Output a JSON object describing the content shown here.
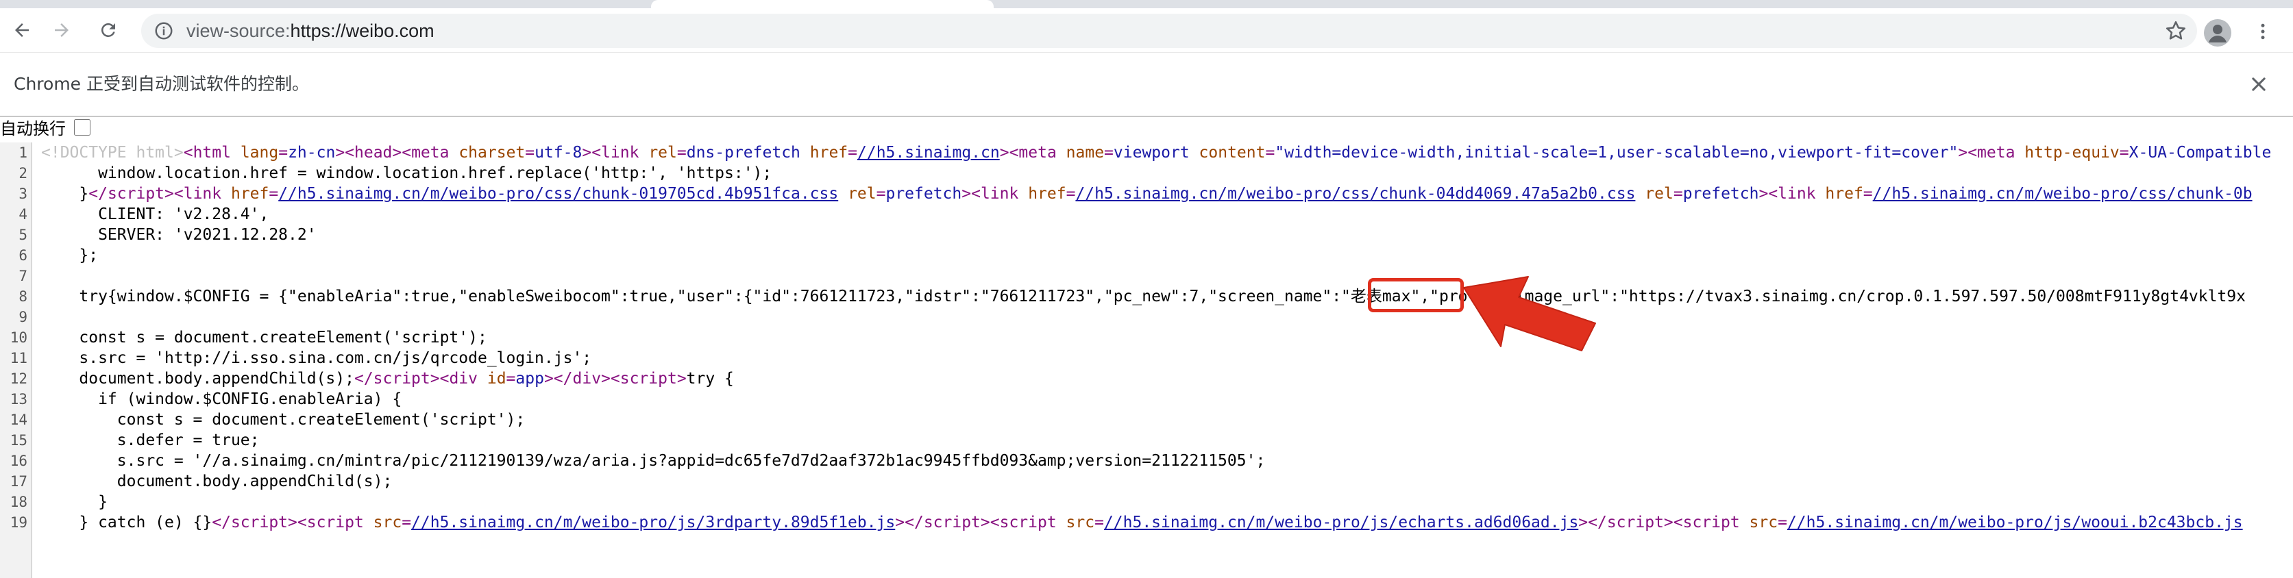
{
  "browser": {
    "url_scheme": "view-source:",
    "url_rest": "https://weibo.com"
  },
  "infobar": {
    "message": "Chrome 正受到自动测试软件的控制。"
  },
  "wrap_toggle": {
    "label": "自动换行"
  },
  "source_lines": [
    {
      "num": "1",
      "html": "<span class=\"doct\">&lt;!DOCTYPE html&gt;</span><span class=\"tag\">&lt;html </span><span class=\"attr\">lang</span><span class=\"tag\">=</span><span class=\"val\">zh-cn</span><span class=\"tag\">&gt;&lt;head&gt;&lt;meta </span><span class=\"attr\">charset</span><span class=\"tag\">=</span><span class=\"val\">utf-8</span><span class=\"tag\">&gt;&lt;link </span><span class=\"attr\">rel</span><span class=\"tag\">=</span><span class=\"val\">dns-prefetch</span><span class=\"tag\"> </span><span class=\"attr\">href</span><span class=\"tag\">=</span><span class=\"lnk\">//h5.sinaimg.cn</span><span class=\"tag\">&gt;&lt;meta </span><span class=\"attr\">name</span><span class=\"tag\">=</span><span class=\"val\">viewport</span><span class=\"tag\"> </span><span class=\"attr\">content</span><span class=\"tag\">=</span><span class=\"val\">\"width=device-width,initial-scale=1,user-scalable=no,viewport-fit=cover\"</span><span class=\"tag\">&gt;&lt;meta </span><span class=\"attr\">http-equiv</span><span class=\"tag\">=</span><span class=\"val\">X-UA-Compatible</span>"
    },
    {
      "num": "2",
      "html": "      window.location.href = window.location.href.replace('http:', 'https:');"
    },
    {
      "num": "3",
      "html": "    }<span class=\"tag\">&lt;/script&gt;&lt;link </span><span class=\"attr\">href</span><span class=\"tag\">=</span><span class=\"lnk\">//h5.sinaimg.cn/m/weibo-pro/css/chunk-019705cd.4b951fca.css</span><span class=\"tag\"> </span><span class=\"attr\">rel</span><span class=\"tag\">=</span><span class=\"val\">prefetch</span><span class=\"tag\">&gt;&lt;link </span><span class=\"attr\">href</span><span class=\"tag\">=</span><span class=\"lnk\">//h5.sinaimg.cn/m/weibo-pro/css/chunk-04dd4069.47a5a2b0.css</span><span class=\"tag\"> </span><span class=\"attr\">rel</span><span class=\"tag\">=</span><span class=\"val\">prefetch</span><span class=\"tag\">&gt;&lt;link </span><span class=\"attr\">href</span><span class=\"tag\">=</span><span class=\"lnk\">//h5.sinaimg.cn/m/weibo-pro/css/chunk-0b</span>"
    },
    {
      "num": "4",
      "html": "      CLIENT: 'v2.28.4',"
    },
    {
      "num": "5",
      "html": "      SERVER: 'v2021.12.28.2'"
    },
    {
      "num": "6",
      "html": "    };"
    },
    {
      "num": "7",
      "html": ""
    },
    {
      "num": "8",
      "html": "    try{window.$CONFIG = {\"enableAria\":true,\"enableSweibocom\":true,\"user\":{\"id\":7661211723,\"idstr\":\"7661211723\",\"pc_new\":7,\"screen_name\":\"老表max\",\"profile_image_url\":\"https://tvax3.sinaimg.cn/crop.0.1.597.597.50/008mtF911y8gt4vklt9x"
    },
    {
      "num": "9",
      "html": ""
    },
    {
      "num": "10",
      "html": "    const s = document.createElement('script');"
    },
    {
      "num": "11",
      "html": "    s.src = 'http://i.sso.sina.com.cn/js/qrcode_login.js';"
    },
    {
      "num": "12",
      "html": "    document.body.appendChild(s);<span class=\"tag\">&lt;/script&gt;&lt;div </span><span class=\"attr\">id</span><span class=\"tag\">=</span><span class=\"val\">app</span><span class=\"tag\">&gt;&lt;/div&gt;&lt;script&gt;</span>try {"
    },
    {
      "num": "13",
      "html": "      if (window.$CONFIG.enableAria) {"
    },
    {
      "num": "14",
      "html": "        const s = document.createElement('script');"
    },
    {
      "num": "15",
      "html": "        s.defer = true;"
    },
    {
      "num": "16",
      "html": "        s.src = '//a.sinaimg.cn/mintra/pic/2112190139/wza/aria.js?appid=dc65fe7d7d2aaf372b1ac9945ffbd093&amp;amp;version=2112211505';"
    },
    {
      "num": "17",
      "html": "        document.body.appendChild(s);"
    },
    {
      "num": "18",
      "html": "      }"
    },
    {
      "num": "19",
      "html": "    } catch (e) {}<span class=\"tag\">&lt;/script&gt;&lt;script </span><span class=\"attr\">src</span><span class=\"tag\">=</span><span class=\"lnk\">//h5.sinaimg.cn/m/weibo-pro/js/3rdparty.89d5f1eb.js</span><span class=\"tag\">&gt;&lt;/script&gt;&lt;script </span><span class=\"attr\">src</span><span class=\"tag\">=</span><span class=\"lnk\">//h5.sinaimg.cn/m/weibo-pro/js/echarts.ad6d06ad.js</span><span class=\"tag\">&gt;&lt;/script&gt;&lt;script </span><span class=\"attr\">src</span><span class=\"tag\">=</span><span class=\"lnk\">//h5.sinaimg.cn/m/weibo-pro/js/wooui.b2c43bcb.js</span>"
    }
  ],
  "icons": {
    "back": "back-arrow-icon",
    "forward": "forward-arrow-icon",
    "reload": "reload-icon",
    "info": "info-icon",
    "star": "star-icon",
    "profile": "profile-icon",
    "menu": "kebab-menu-icon",
    "close": "close-icon",
    "annotation": "red-arrow-icon"
  },
  "colors": {
    "annotation": "#e0301e",
    "tag": "#881280",
    "attribute": "#994500",
    "value": "#1a1aa6"
  }
}
